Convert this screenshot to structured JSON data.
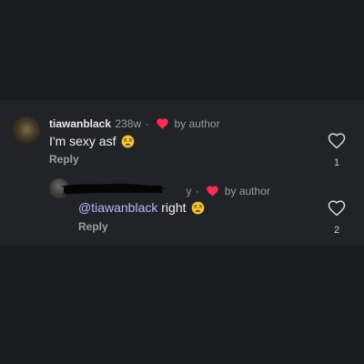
{
  "comments": [
    {
      "username": "tiawanblack",
      "age": "238w",
      "separator": "·",
      "liked_by": "by author",
      "text": "I'm sexy asf",
      "emoji": "weary-face-emoji",
      "reply_label": "Reply",
      "like_count": "1"
    },
    {
      "username_visible_fragment": "y",
      "separator": "·",
      "liked_by": "by author",
      "mention": "@tiawanblack",
      "text": "right",
      "emoji": "weary-face-emoji",
      "reply_label": "Reply",
      "like_count": "2"
    }
  ],
  "colors": {
    "background": "#1a1b1f",
    "panel": "#222327",
    "heart_red": "#fe2c55",
    "mention": "#b5b8ff",
    "muted_text": "#9a9ba0"
  },
  "icons": {
    "like": "heart-outline-icon",
    "author_like": "heart-filled-icon"
  }
}
